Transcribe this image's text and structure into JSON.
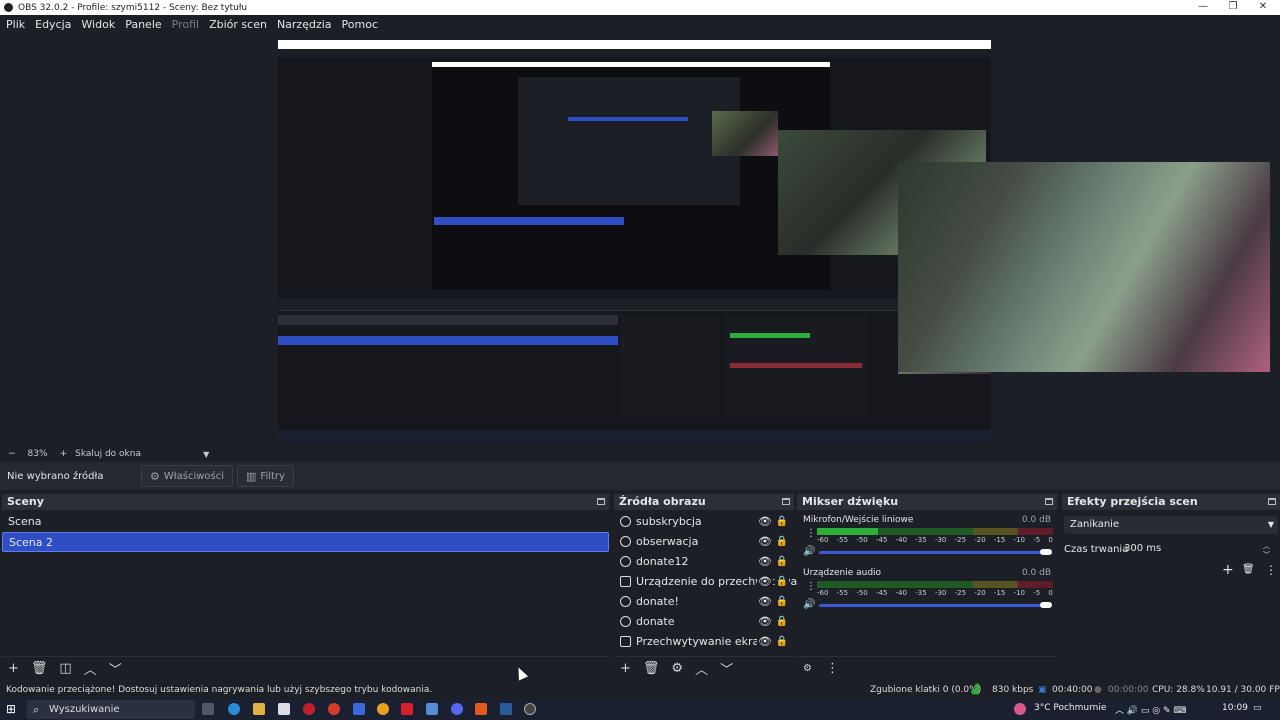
{
  "window": {
    "title": "OBS 32.0.2 - Profile: szymi5112 - Sceny: Bez tytułu",
    "minimize": "—",
    "maximize": "❐",
    "close": "✕"
  },
  "menu": {
    "items": [
      "Plik",
      "Edycja",
      "Widok",
      "Panele",
      "Profil",
      "Zbiór scen",
      "Narzędzia",
      "Pomoc"
    ]
  },
  "zoom": {
    "minus": "−",
    "value": "83%",
    "plus": "+",
    "mode": "Skaluj do okna"
  },
  "source_toolbar": {
    "no_source": "Nie wybrano źródła",
    "properties": "Właściwości",
    "filters": "Filtry"
  },
  "scenes": {
    "title": "Sceny",
    "items": [
      "Scena",
      "Scena 2"
    ],
    "selected_index": 1
  },
  "sources": {
    "title": "Źródła obrazu",
    "items": [
      {
        "label": "subskrybcja",
        "icon": "browser-icon"
      },
      {
        "label": "obserwacja",
        "icon": "browser-icon"
      },
      {
        "label": "donate12",
        "icon": "browser-icon"
      },
      {
        "label": "Urządzenie do przechwytywania obrazu",
        "icon": "camera-icon"
      },
      {
        "label": "donate!",
        "icon": "browser-icon"
      },
      {
        "label": "donate",
        "icon": "browser-icon"
      },
      {
        "label": "Przechwytywanie ekranu",
        "icon": "monitor-icon"
      }
    ]
  },
  "mixer": {
    "title": "Mikser dźwięku",
    "channels": [
      {
        "name": "Mikrofon/Wejście liniowe",
        "db": "0.0 dB",
        "level": 0.26
      },
      {
        "name": "Urządzenie audio",
        "db": "0.0 dB",
        "level": 0
      }
    ],
    "ticks": [
      "-60",
      "-55",
      "-50",
      "-45",
      "-40",
      "-35",
      "-30",
      "-25",
      "-20",
      "-15",
      "-10",
      "-5",
      "0"
    ]
  },
  "transitions": {
    "title": "Efekty przejścia scen",
    "selected": "Zanikanie",
    "duration_label": "Czas trwania",
    "duration_value": "300 ms"
  },
  "status": {
    "message": "Kodowanie przeciążone! Dostosuj ustawienia nagrywania lub użyj szybszego trybu kodowania.",
    "dropped_frames": "Zgubione klatki 0 (0.0%)",
    "bitrate": "830 kbps",
    "stream_time": "00:40:00",
    "rec_time": "00:00:00",
    "cpu": "CPU: 28.8%",
    "fps": "10.91 / 30.00 FPS"
  },
  "taskbar": {
    "search_placeholder": "Wyszukiwanie",
    "weather": "3°C  Pochmurnie",
    "time": "10:09"
  },
  "colors": {
    "accent": "#2f4ec4",
    "bg": "#1d1f26",
    "meter_green": "#2eae3a",
    "meter_yellow": "#a7a32a",
    "meter_red": "#b3283c"
  }
}
